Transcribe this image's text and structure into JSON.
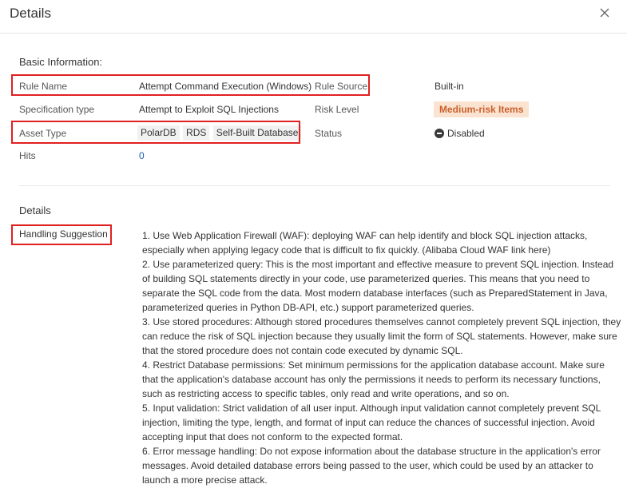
{
  "dialog": {
    "title": "Details"
  },
  "basic": {
    "section_title": "Basic Information:",
    "rule_name_label": "Rule Name",
    "rule_name_value": "Attempt Command Execution (Windows)",
    "rule_source_label": "Rule Source",
    "rule_source_value": "Built-in",
    "spec_type_label": "Specification type",
    "spec_type_value": "Attempt to Exploit SQL Injections",
    "risk_level_label": "Risk Level",
    "risk_level_value": "Medium-risk Items",
    "asset_type_label": "Asset Type",
    "asset_types": [
      "PolarDB",
      "RDS",
      "Self-Built Database"
    ],
    "status_label": "Status",
    "status_value": "Disabled",
    "hits_label": "Hits",
    "hits_value": "0"
  },
  "details": {
    "section_title": "Details",
    "handling_label": "Handling Suggestion",
    "suggestions": [
      "1. Use Web Application Firewall (WAF): deploying WAF can help identify and block SQL injection attacks, especially when applying legacy code that is difficult to fix quickly. (Alibaba Cloud WAF link here)",
      "2. Use parameterized query: This is the most important and effective measure to prevent SQL injection. Instead of building SQL statements directly in your code, use parameterized queries. This means that you need to separate the SQL code from the data. Most modern database interfaces (such as PreparedStatement in Java, parameterized queries in Python DB-API, etc.) support parameterized queries.",
      "3. Use stored procedures: Although stored procedures themselves cannot completely prevent SQL injection, they can reduce the risk of SQL injection because they usually limit the form of SQL statements. However, make sure that the stored procedure does not contain code executed by dynamic SQL.",
      "4. Restrict Database permissions: Set minimum permissions for the application database account. Make sure that the application's database account has only the permissions it needs to perform its necessary functions, such as restricting access to specific tables, only read and write operations, and so on.",
      "5. Input validation: Strict validation of all user input. Although input validation cannot completely prevent SQL injection, limiting the type, length, and format of input can reduce the chances of successful injection. Avoid accepting input that does not conform to the expected format.",
      "6. Error message handling: Do not expose information about the database structure in the application's error messages. Avoid detailed database errors being passed to the user, which could be used by an attacker to launch a more precise attack."
    ]
  },
  "colors": {
    "highlight": "#e02020",
    "badge_bg": "#fbe3d2",
    "badge_text": "#c9612a",
    "link": "#1a5fb4"
  },
  "icons": {
    "close": "close-icon",
    "status": "disabled-status-icon"
  }
}
